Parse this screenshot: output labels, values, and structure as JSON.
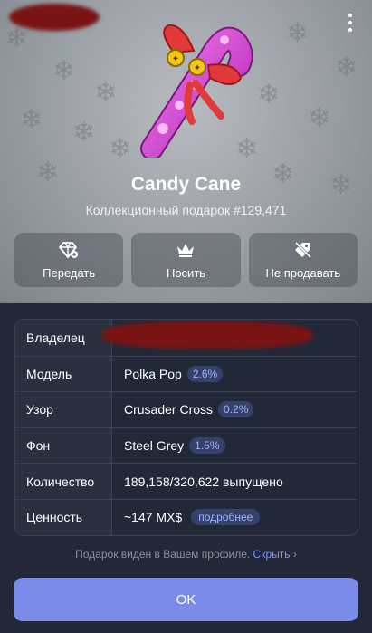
{
  "gift": {
    "name": "Candy Cane",
    "subtitle": "Коллекционный подарок #129,471"
  },
  "actions": [
    {
      "label": "Передать",
      "icon": "transfer-gem-icon"
    },
    {
      "label": "Носить",
      "icon": "crown-icon"
    },
    {
      "label": "Не продавать",
      "icon": "no-sale-tag-icon"
    }
  ],
  "details": {
    "owner_label": "Владелец",
    "model_label": "Модель",
    "model_value": "Polka Pop",
    "model_pct": "2.6%",
    "pattern_label": "Узор",
    "pattern_value": "Crusader Cross",
    "pattern_pct": "0.2%",
    "background_label": "Фон",
    "background_value": "Steel Grey",
    "background_pct": "1.5%",
    "quantity_label": "Количество",
    "quantity_value": "189,158/320,622 выпущено",
    "value_label": "Ценность",
    "value_value": "~147 MX$",
    "value_more": "подробнее"
  },
  "footer": {
    "note": "Подарок виден в Вашем профиле.",
    "hide_link": "Скрыть",
    "ok_label": "OK"
  },
  "colors": {
    "accent": "#7b8be8",
    "link": "#7a95ff",
    "badge_bg": "#37426a",
    "badge_text": "#9fb3ff",
    "background": "#232838"
  }
}
